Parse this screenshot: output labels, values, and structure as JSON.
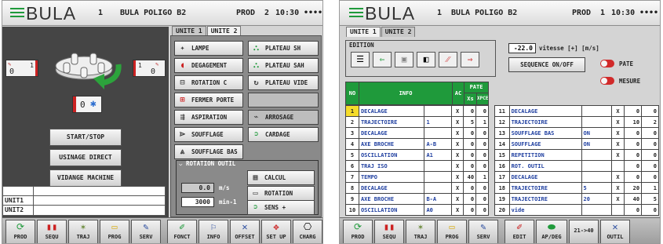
{
  "left": {
    "header": {
      "logo": "BULA",
      "unit_num": "1",
      "title": "BULA POLIGO B2",
      "mode": "PROD",
      "count": "2",
      "time": "10:30",
      "dots": "••••"
    },
    "counter_left": {
      "value": "0",
      "num": "1"
    },
    "counter_right": {
      "value": "0",
      "num": "1"
    },
    "station_box": {
      "value": "0"
    },
    "buttons": [
      "START/STOP",
      "USINAGE DIRECT",
      "VIDANGE MACHINE"
    ],
    "units": [
      "UNIT1",
      "UNIT2"
    ],
    "tabs": [
      "UNITE 1",
      "UNITE 2"
    ],
    "panel_buttons": {
      "lampe": "LAMPE",
      "plateau_sh": "PLATEAU SH",
      "degagement": "DEGAGEMENT",
      "plateau_sah": "PLATEAU SAH",
      "rotation_c": "ROTATION C",
      "plateau_vide": "PLATEAU VIDE",
      "fermer_porte": "FERMER PORTE",
      "aspiration": "ASPIRATION",
      "arrosage": "ARROSAGE",
      "soufflage": "SOUFFLAGE",
      "cardage": "CARDAGE",
      "soufflage_bas": "SOUFFLAGE BAS"
    },
    "rotation": {
      "title": "ROTATION OUTIL",
      "speed_value": "0.0",
      "speed_unit": "m/s",
      "rpm_value": "3000",
      "rpm_unit": "min-1",
      "calcul": "CALCUL",
      "rotation_btn": "ROTATION",
      "sens": "SENS +"
    },
    "footer": [
      {
        "label": "PROD",
        "icon": "refresh-icon"
      },
      {
        "label": "SEQU",
        "icon": "sequence-icon"
      },
      {
        "label": "TRAJ",
        "icon": "trajectory-icon"
      },
      {
        "label": "PROG",
        "icon": "folder-icon"
      },
      {
        "label": "SERV",
        "icon": "service-icon"
      },
      {
        "label": "FONCT",
        "icon": "function-icon"
      },
      {
        "label": "INFO",
        "icon": "info-icon"
      },
      {
        "label": "OFFSET",
        "icon": "offset-icon"
      },
      {
        "label": "SET UP",
        "icon": "setup-icon"
      },
      {
        "label": "CHARG",
        "icon": "load-icon"
      }
    ]
  },
  "right": {
    "header": {
      "logo": "BULA",
      "unit_num": "1",
      "title": "BULA POLIGO B2",
      "mode": "PROD",
      "count": "1",
      "time": "10:30",
      "dots": "••••"
    },
    "tabs": [
      "UNITE 1",
      "UNITE 2"
    ],
    "edition_title": "EDITION",
    "speed": {
      "value": "-22.0",
      "label": "vitesse [+] [m/s]"
    },
    "sequence_btn": "SEQUENCE ON/OFF",
    "toggles": [
      {
        "state": "OFF",
        "label": "PATE"
      },
      {
        "state": "OFF",
        "label": "MESURE"
      }
    ],
    "table_headers": {
      "no": "NO",
      "info": "INFO",
      "ac": "AC",
      "pate": "PATE",
      "xs": "Xs",
      "xpce": "XPCE"
    },
    "rows_left": [
      {
        "no": "1",
        "info": "DECALAGE",
        "param": "",
        "ac": "X",
        "xs": "0",
        "xpce": "0"
      },
      {
        "no": "2",
        "info": "TRAJECTOIRE",
        "param": "1",
        "ac": "X",
        "xs": "5",
        "xpce": "1"
      },
      {
        "no": "3",
        "info": "DECALAGE",
        "param": "",
        "ac": "X",
        "xs": "0",
        "xpce": "0"
      },
      {
        "no": "4",
        "info": "AXE BROCHE",
        "param": "A-B",
        "ac": "X",
        "xs": "0",
        "xpce": "0"
      },
      {
        "no": "5",
        "info": "OSCILLATION",
        "param": "A1",
        "ac": "X",
        "xs": "0",
        "xpce": "0"
      },
      {
        "no": "6",
        "info": "TRAJ ISO",
        "param": "",
        "ac": "X",
        "xs": "0",
        "xpce": "0"
      },
      {
        "no": "7",
        "info": "TEMPO",
        "param": "",
        "ac": "X",
        "xs": "40",
        "xpce": "1"
      },
      {
        "no": "8",
        "info": "DECALAGE",
        "param": "",
        "ac": "X",
        "xs": "0",
        "xpce": "0"
      },
      {
        "no": "9",
        "info": "AXE BROCHE",
        "param": "B-A",
        "ac": "X",
        "xs": "0",
        "xpce": "0"
      },
      {
        "no": "10",
        "info": "OSCILLATION",
        "param": "A0",
        "ac": "X",
        "xs": "0",
        "xpce": "0"
      }
    ],
    "rows_right": [
      {
        "no": "11",
        "info": "DECALAGE",
        "param": "",
        "ac": "X",
        "xs": "0",
        "xpce": "0"
      },
      {
        "no": "12",
        "info": "TRAJECTOIRE",
        "param": "",
        "ac": "X",
        "xs": "10",
        "xpce": "2"
      },
      {
        "no": "13",
        "info": "SOUFFLAGE BAS",
        "param": "ON",
        "ac": "X",
        "xs": "0",
        "xpce": "0"
      },
      {
        "no": "14",
        "info": "SOUFFLAGE",
        "param": "ON",
        "ac": "X",
        "xs": "0",
        "xpce": "0"
      },
      {
        "no": "15",
        "info": "REPETITION",
        "param": "",
        "ac": "X",
        "xs": "0",
        "xpce": "0"
      },
      {
        "no": "16",
        "info": "ROT. OUTIL",
        "param": "",
        "ac": "",
        "xs": "0",
        "xpce": "0"
      },
      {
        "no": "17",
        "info": "DECALAGE",
        "param": "",
        "ac": "X",
        "xs": "0",
        "xpce": "0"
      },
      {
        "no": "18",
        "info": "TRAJECTOIRE",
        "param": "5",
        "ac": "X",
        "xs": "20",
        "xpce": "1"
      },
      {
        "no": "19",
        "info": "TRAJECTOIRE",
        "param": "20",
        "ac": "X",
        "xs": "40",
        "xpce": "5"
      },
      {
        "no": "20",
        "info": "vide",
        "param": "",
        "ac": "",
        "xs": "0",
        "xpce": "0"
      }
    ],
    "footer": [
      {
        "label": "PROD",
        "icon": "refresh-icon"
      },
      {
        "label": "SEQU",
        "icon": "sequence-icon"
      },
      {
        "label": "TRAJ",
        "icon": "trajectory-icon"
      },
      {
        "label": "PROG",
        "icon": "folder-icon"
      },
      {
        "label": "SERV",
        "icon": "service-icon"
      },
      {
        "label": "EDIT",
        "icon": "edit-icon"
      },
      {
        "label": "AP/DEG",
        "icon": "ap-deg-icon"
      },
      {
        "label": "21->40",
        "icon": ""
      },
      {
        "label": "OUTIL",
        "icon": "tool-icon"
      }
    ]
  }
}
